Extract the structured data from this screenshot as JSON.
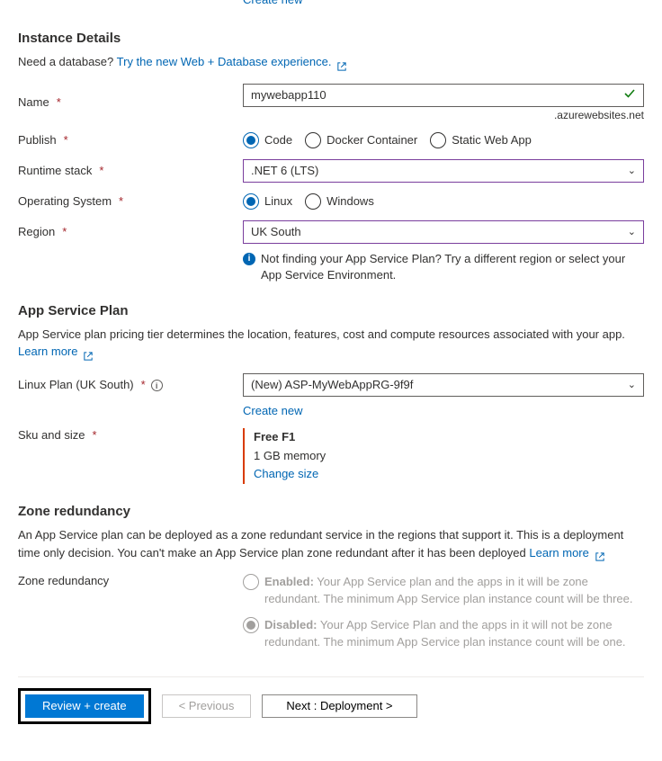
{
  "top_partial_link": "Create new",
  "instance_details": {
    "title": "Instance Details",
    "db_prompt": "Need a database?",
    "db_link": "Try the new Web + Database experience.",
    "name_label": "Name",
    "name_value": "mywebapp110",
    "name_suffix": ".azurewebsites.net",
    "publish_label": "Publish",
    "publish_options": {
      "code": "Code",
      "docker": "Docker Container",
      "static": "Static Web App"
    },
    "runtime_label": "Runtime stack",
    "runtime_value": ".NET 6 (LTS)",
    "os_label": "Operating System",
    "os_options": {
      "linux": "Linux",
      "windows": "Windows"
    },
    "region_label": "Region",
    "region_value": "UK South",
    "region_info": "Not finding your App Service Plan? Try a different region or select your App Service Environment."
  },
  "app_service_plan": {
    "title": "App Service Plan",
    "desc": "App Service plan pricing tier determines the location, features, cost and compute resources associated with your app.",
    "learn_more": "Learn more",
    "plan_label": "Linux Plan (UK South)",
    "plan_value": "(New) ASP-MyWebAppRG-9f9f",
    "create_new": "Create new",
    "sku_label": "Sku and size",
    "sku_name": "Free F1",
    "sku_detail": "1 GB memory",
    "sku_change": "Change size"
  },
  "zone": {
    "title": "Zone redundancy",
    "desc": "An App Service plan can be deployed as a zone redundant service in the regions that support it. This is a deployment time only decision. You can't make an App Service plan zone redundant after it has been deployed",
    "learn_more": "Learn more",
    "label": "Zone redundancy",
    "enabled_label": "Enabled:",
    "enabled_text": " Your App Service plan and the apps in it will be zone redundant. The minimum App Service plan instance count will be three.",
    "disabled_label": "Disabled:",
    "disabled_text": " Your App Service Plan and the apps in it will not be zone redundant. The minimum App Service plan instance count will be one."
  },
  "footer": {
    "review": "Review + create",
    "previous": "< Previous",
    "next": "Next : Deployment >"
  }
}
